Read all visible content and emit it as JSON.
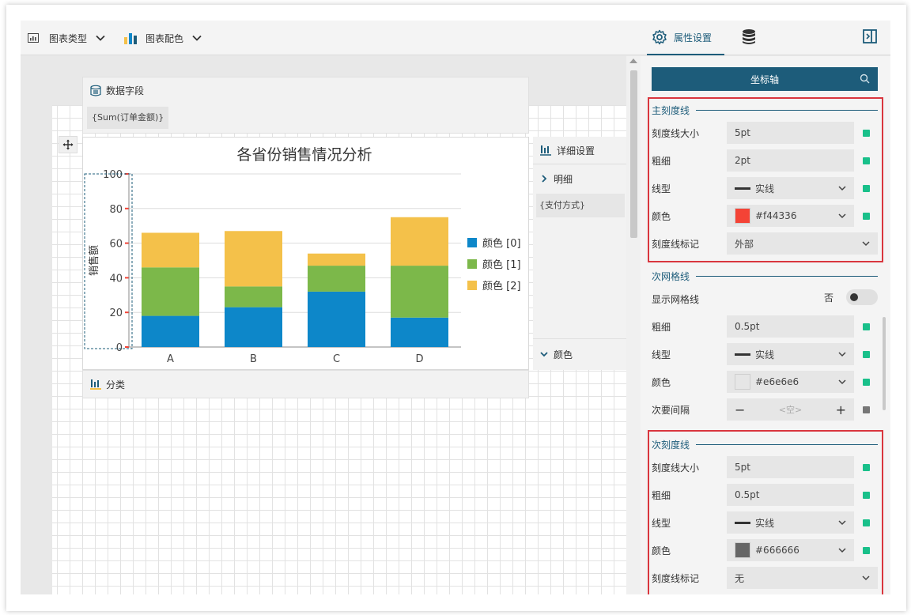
{
  "toolbar": {
    "chart_type_label": "图表类型",
    "chart_color_label": "图表配色",
    "properties_tab": "属性设置"
  },
  "canvas": {
    "data_fields_title": "数据字段",
    "data_field_chip": "{Sum(订单金额)}",
    "category_title": "分类",
    "detail_title": "详细设置",
    "detail_item": "明细",
    "detail_chip": "{支付方式}",
    "detail_color": "颜色"
  },
  "chart_data": {
    "type": "bar",
    "stacked": true,
    "title": "各省份销售情况分析",
    "ylabel": "销售额",
    "xlabel": "",
    "categories": [
      "A",
      "B",
      "C",
      "D"
    ],
    "series": [
      {
        "name": "颜色 [0]",
        "color": "#0d87c9",
        "values": [
          18,
          23,
          32,
          17
        ]
      },
      {
        "name": "颜色 [1]",
        "color": "#7cb84a",
        "values": [
          28,
          12,
          15,
          30
        ]
      },
      {
        "name": "颜色 [2]",
        "color": "#f4c14a",
        "values": [
          20,
          32,
          7,
          28
        ]
      }
    ],
    "ylim": [
      0,
      100
    ],
    "yticks": [
      "0",
      "20",
      "40",
      "60",
      "80",
      "100"
    ],
    "grid": true,
    "legend": "right"
  },
  "panel": {
    "axis_button": "坐标轴",
    "major_tick": {
      "title": "主刻度线",
      "size_label": "刻度线大小",
      "size_value": "5pt",
      "thickness_label": "粗细",
      "thickness_value": "2pt",
      "linetype_label": "线型",
      "linetype_value": "实线",
      "color_label": "颜色",
      "color_value": "#f44336",
      "color_swatch": "#f44336",
      "mark_label": "刻度线标记",
      "mark_value": "外部"
    },
    "minor_grid": {
      "title": "次网格线",
      "show_label": "显示网格线",
      "show_value": "否",
      "thickness_label": "粗细",
      "thickness_value": "0.5pt",
      "linetype_label": "线型",
      "linetype_value": "实线",
      "color_label": "颜色",
      "color_value": "#e6e6e6",
      "color_swatch": "#e6e6e6",
      "interval_label": "次要间隔",
      "interval_value": "<空>",
      "minus": "−",
      "plus": "+"
    },
    "minor_tick": {
      "title": "次刻度线",
      "size_label": "刻度线大小",
      "size_value": "5pt",
      "thickness_label": "粗细",
      "thickness_value": "0.5pt",
      "linetype_label": "线型",
      "linetype_value": "实线",
      "color_label": "颜色",
      "color_value": "#666666",
      "color_swatch": "#666666",
      "mark_label": "刻度线标记",
      "mark_value": "无"
    }
  }
}
